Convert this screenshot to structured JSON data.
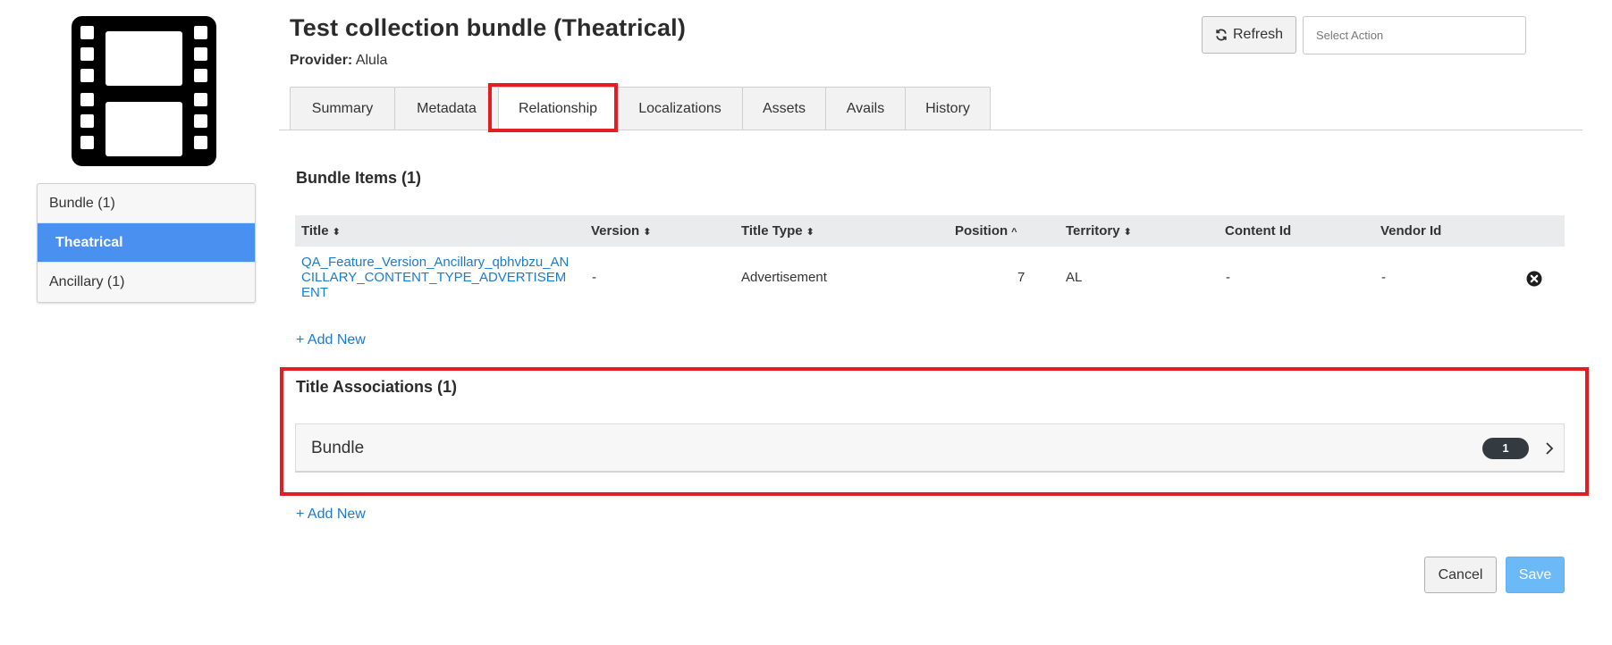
{
  "header": {
    "title": "Test collection bundle (Theatrical)",
    "provider_label": "Provider:",
    "provider_value": "Alula",
    "refresh_label": "Refresh",
    "select_action_placeholder": "Select Action"
  },
  "sidebar": {
    "items": [
      {
        "label": "Bundle (1)",
        "active": false
      },
      {
        "label": "Theatrical",
        "active": true
      },
      {
        "label": "Ancillary (1)",
        "active": false
      }
    ]
  },
  "tabs": [
    {
      "label": "Summary",
      "active": false
    },
    {
      "label": "Metadata",
      "active": false
    },
    {
      "label": "Relationship",
      "active": true
    },
    {
      "label": "Localizations",
      "active": false
    },
    {
      "label": "Assets",
      "active": false
    },
    {
      "label": "Avails",
      "active": false
    },
    {
      "label": "History",
      "active": false
    }
  ],
  "bundle_items": {
    "heading": "Bundle Items (1)",
    "columns": {
      "title": "Title",
      "version": "Version",
      "title_type": "Title Type",
      "position": "Position",
      "territory": "Territory",
      "content_id": "Content Id",
      "vendor_id": "Vendor Id"
    },
    "sort_icons": {
      "both": "⬍",
      "asc": "^"
    },
    "rows": [
      {
        "title": "QA_Feature_Version_Ancillary_qbhvbzu_ANCILLARY_CONTENT_TYPE_ADVERTISEMENT",
        "version": "-",
        "title_type": "Advertisement",
        "position": "7",
        "territory": "AL",
        "content_id": "-",
        "vendor_id": "-"
      }
    ],
    "add_new": "+ Add New"
  },
  "title_associations": {
    "heading": "Title Associations (1)",
    "items": [
      {
        "label": "Bundle",
        "count": "1"
      }
    ],
    "add_new": "+ Add New"
  },
  "footer": {
    "cancel_label": "Cancel",
    "save_label": "Save"
  },
  "colors": {
    "accent": "#4a90f0",
    "link": "#1b7bd0",
    "highlight": "#e41c24",
    "save": "#6cb9f7"
  }
}
